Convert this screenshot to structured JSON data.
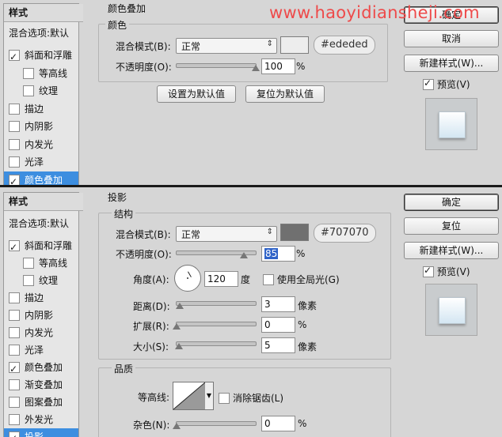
{
  "watermark": "www.haoyidiansheji.com",
  "top": {
    "sidebar": {
      "header": "样式",
      "blending_options": "混合选项:默认",
      "items": [
        {
          "label": "斜面和浮雕",
          "checked": true
        },
        {
          "label": "等高线",
          "checked": false
        },
        {
          "label": "纹理",
          "checked": false
        },
        {
          "label": "描边",
          "checked": false
        },
        {
          "label": "内阴影",
          "checked": false
        },
        {
          "label": "内发光",
          "checked": false
        },
        {
          "label": "光泽",
          "checked": false
        },
        {
          "label": "颜色叠加",
          "checked": true,
          "selected": true
        }
      ]
    },
    "section_title": "颜色叠加",
    "group_title": "颜色",
    "blend_mode_label": "混合模式(B):",
    "blend_mode_value": "正常",
    "swatch_color": "#ededed",
    "hex": "#ededed",
    "opacity_label": "不透明度(O):",
    "opacity_value": "100",
    "percent": "%",
    "opacity_fraction": 1.0,
    "set_default": "设置为默认值",
    "reset_default": "复位为默认值",
    "buttons": {
      "ok": "确定",
      "cancel": "取消",
      "new_style": "新建样式(W)...",
      "preview": "预览(V)"
    },
    "preview_checked": true
  },
  "bottom": {
    "sidebar": {
      "header": "样式",
      "blending_options": "混合选项:默认",
      "items": [
        {
          "label": "斜面和浮雕",
          "checked": true
        },
        {
          "label": "等高线",
          "checked": false
        },
        {
          "label": "纹理",
          "checked": false
        },
        {
          "label": "描边",
          "checked": false
        },
        {
          "label": "内阴影",
          "checked": false
        },
        {
          "label": "内发光",
          "checked": false
        },
        {
          "label": "光泽",
          "checked": false
        },
        {
          "label": "颜色叠加",
          "checked": true
        },
        {
          "label": "渐变叠加",
          "checked": false
        },
        {
          "label": "图案叠加",
          "checked": false
        },
        {
          "label": "外发光",
          "checked": false
        },
        {
          "label": "投影",
          "checked": true,
          "selected": true
        }
      ]
    },
    "section_title": "投影",
    "structure_title": "结构",
    "blend_mode_label": "混合模式(B):",
    "blend_mode_value": "正常",
    "swatch_color": "#707070",
    "hex": "#707070",
    "opacity_label": "不透明度(O):",
    "opacity_value": "85",
    "opacity_fraction": 0.85,
    "percent": "%",
    "angle_label": "角度(A):",
    "angle_value": "120",
    "degree": "度",
    "global_light": "使用全局光(G)",
    "global_light_checked": false,
    "distance_label": "距离(D):",
    "distance_value": "3",
    "distance_unit": "像素",
    "spread_label": "扩展(R):",
    "spread_value": "0",
    "spread_unit": "%",
    "size_label": "大小(S):",
    "size_value": "5",
    "size_unit": "像素",
    "quality_title": "品质",
    "contour_label": "等高线:",
    "antialias": "消除锯齿(L)",
    "antialias_checked": false,
    "noise_label": "杂色(N):",
    "noise_value": "0",
    "noise_unit": "%",
    "buttons": {
      "ok": "确定",
      "reset": "复位",
      "new_style": "新建样式(W)...",
      "preview": "预览(V)"
    },
    "preview_checked": true
  }
}
